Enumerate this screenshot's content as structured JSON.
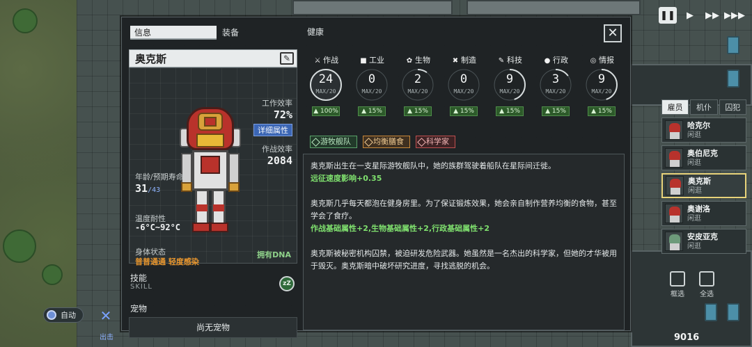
{
  "panel": {
    "tabs": [
      "信息",
      "装备",
      "健康"
    ],
    "close_label": "✕"
  },
  "character": {
    "name": "奥克斯",
    "work_efficiency_label": "工作效率",
    "work_efficiency_value": "72%",
    "detail_button": "详细属性",
    "combat_efficiency_label": "作战效率",
    "combat_efficiency_value": "2084",
    "age_label": "年龄/预期寿命",
    "age_value": "31",
    "age_expected": "/43",
    "temp_label": "温度耐性",
    "temp_value": "-6°C~92°C",
    "body_label": "身体状态",
    "body_value": "普普通通 轻度感染",
    "dna_label": "拥有DNA",
    "skill_label": "技能",
    "skill_sub": "SKILL",
    "skill_icon_text": "zZ",
    "pet_label": "宠物",
    "pet_value": "尚无宠物"
  },
  "attributes": [
    {
      "name": "作战",
      "icon": "⚔",
      "value": "24",
      "max": "MAX/20",
      "bonus": "▲ 100%",
      "progress": 1.0
    },
    {
      "name": "工业",
      "icon": "■",
      "value": "0",
      "max": "MAX/20",
      "bonus": "▲ 15%",
      "progress": 0.0
    },
    {
      "name": "生物",
      "icon": "✿",
      "value": "2",
      "max": "MAX/20",
      "bonus": "▲ 15%",
      "progress": 0.1
    },
    {
      "name": "制造",
      "icon": "✖",
      "value": "0",
      "max": "MAX/20",
      "bonus": "▲ 15%",
      "progress": 0.0
    },
    {
      "name": "科技",
      "icon": "✎",
      "value": "9",
      "max": "MAX/20",
      "bonus": "▲ 15%",
      "progress": 0.45
    },
    {
      "name": "行政",
      "icon": "●",
      "value": "3",
      "max": "MAX/20",
      "bonus": "▲ 15%",
      "progress": 0.15
    },
    {
      "name": "情报",
      "icon": "◎",
      "value": "9",
      "max": "MAX/20",
      "bonus": "▲ 15%",
      "progress": 0.45
    }
  ],
  "tags": [
    {
      "label": "游牧舰队",
      "style": "green"
    },
    {
      "label": "均衡膳食",
      "style": "orange"
    },
    {
      "label": "科学家",
      "style": "red"
    }
  ],
  "story": {
    "p1": "奥克斯出生在一支星际游牧舰队中，她的族群驾驶着船队在星际间迁徙。",
    "p1_effect": "远征速度影响+0.35",
    "p2": "奥克斯几乎每天都泡在健身房里。为了保证锻炼效果，她会亲自制作营养均衡的食物，甚至学会了食疗。",
    "p2_effect": "作战基础属性+2,生物基础属性+2,行政基础属性+2",
    "p3": "奥克斯被秘密机构囚禁，被迫研发危险武器。她虽然是一名杰出的科学家，但她的才华被用于毁灭。奥克斯暗中破坏研究进度，寻找逃脱的机会。"
  },
  "roster": {
    "tabs": [
      "雇员",
      "机仆",
      "囚犯"
    ],
    "items": [
      {
        "name": "哈克尔",
        "status": "闲逛"
      },
      {
        "name": "奥伯尼克",
        "status": "闲逛"
      },
      {
        "name": "奥克斯",
        "status": "闲逛"
      },
      {
        "name": "奥谢洛",
        "status": "闲逛"
      },
      {
        "name": "安皮亚克",
        "status": "闲逛"
      }
    ]
  },
  "hud": {
    "auto_label": "自动",
    "exit_label": "出击",
    "select_label": "框选",
    "select_all_label": "全选",
    "money": "9016"
  },
  "colors": {
    "panel_bg": "#1e2224",
    "accent_green": "#7fe06e",
    "accent_orange": "#e8962e",
    "accent_blue": "#3b66b5"
  }
}
